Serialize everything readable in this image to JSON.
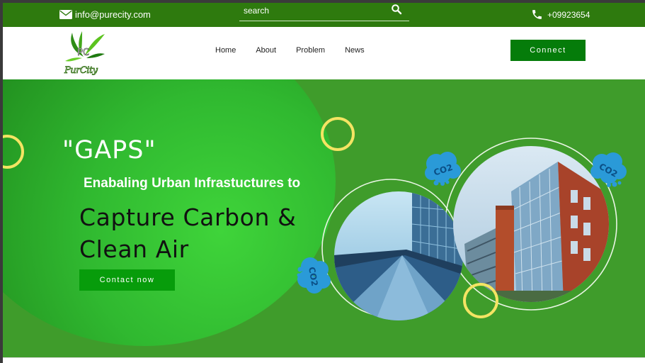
{
  "header": {
    "email": "info@purecity.com",
    "search_placeholder": "search",
    "phone": "+09923654"
  },
  "brand": {
    "logo_initials": "PC",
    "logo_name": "PurCity"
  },
  "nav": {
    "items": [
      {
        "label": "Home"
      },
      {
        "label": "About"
      },
      {
        "label": "Problem"
      },
      {
        "label": "News"
      }
    ],
    "connect_label": "Connect"
  },
  "hero": {
    "quote": "\"GAPS\"",
    "subtitle": "Enabaling Urban Infrastuctures to",
    "headline_line1": "Capture Carbon &",
    "headline_line2": "Clean Air",
    "cta_label": "Contact now",
    "badges": [
      "CO2",
      "CO2",
      "CO2"
    ]
  },
  "colors": {
    "topbar": "#2e7a0e",
    "hero_bg": "#3f9c2b",
    "button_green": "#057c0a",
    "accent_yellow": "#f4e463",
    "badge_blue": "#2a9ad8"
  },
  "icons": {
    "email": "mail-icon",
    "search": "search-icon",
    "phone": "phone-icon",
    "badge": "cloud-co2-icon"
  }
}
